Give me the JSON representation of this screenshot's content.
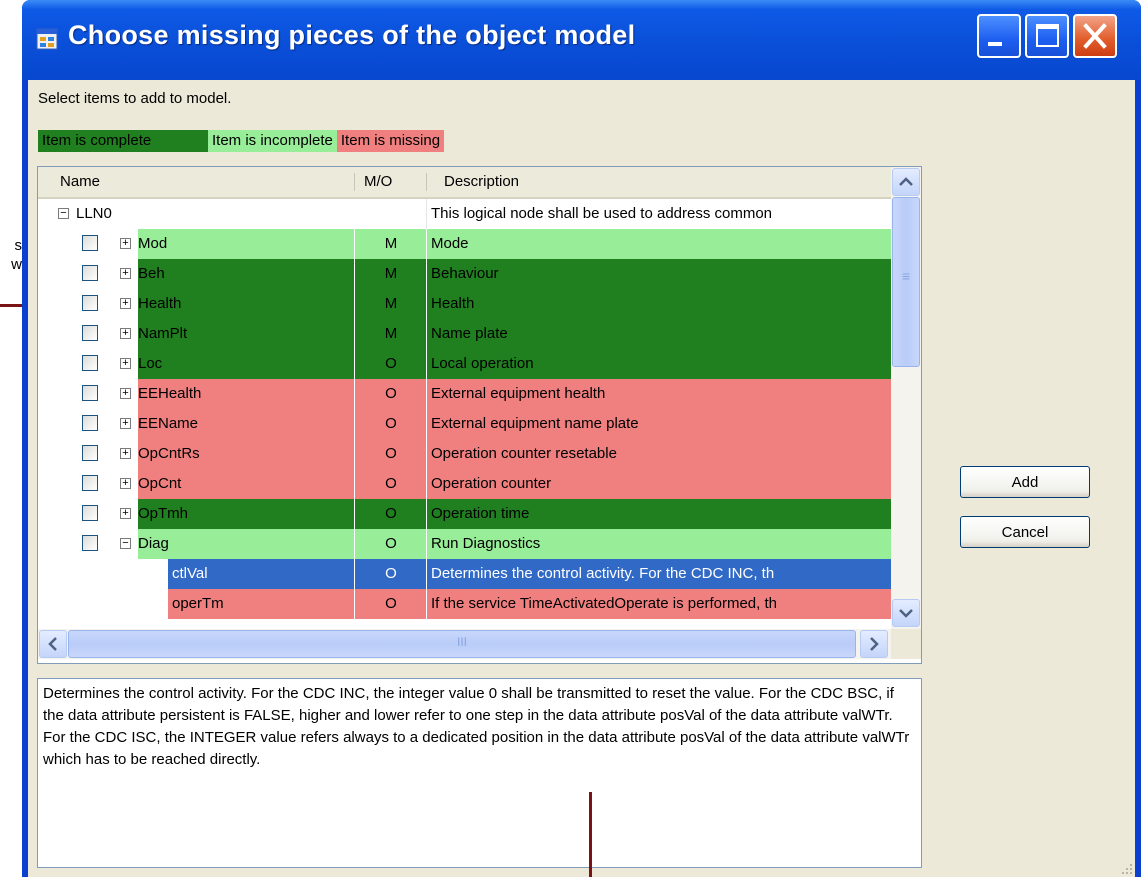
{
  "window": {
    "title": "Choose missing pieces of the object model"
  },
  "annotation_left": "s\nw",
  "instruction": "Select items to add to model.",
  "legend": {
    "complete": "Item is complete",
    "incomplete": "Item is incomplete",
    "missing": "Item is missing"
  },
  "columns": {
    "name": "Name",
    "mo": "M/O",
    "description": "Description"
  },
  "root": {
    "name": "LLN0",
    "description": "This logical node shall be used to address common"
  },
  "rows": [
    {
      "name": "Mod",
      "mo": "M",
      "description": "Mode",
      "status": "incomplete"
    },
    {
      "name": "Beh",
      "mo": "M",
      "description": "Behaviour",
      "status": "complete"
    },
    {
      "name": "Health",
      "mo": "M",
      "description": "Health",
      "status": "complete"
    },
    {
      "name": "NamPlt",
      "mo": "M",
      "description": "Name plate",
      "status": "complete"
    },
    {
      "name": "Loc",
      "mo": "O",
      "description": "Local operation",
      "status": "complete"
    },
    {
      "name": "EEHealth",
      "mo": "O",
      "description": "External equipment health",
      "status": "missing"
    },
    {
      "name": "EEName",
      "mo": "O",
      "description": "External equipment name plate",
      "status": "missing"
    },
    {
      "name": "OpCntRs",
      "mo": "O",
      "description": "Operation counter resetable",
      "status": "missing"
    },
    {
      "name": "OpCnt",
      "mo": "O",
      "description": "Operation counter",
      "status": "missing"
    },
    {
      "name": "OpTmh",
      "mo": "O",
      "description": "Operation time",
      "status": "complete"
    },
    {
      "name": "Diag",
      "mo": "O",
      "description": "Run Diagnostics",
      "status": "incomplete"
    }
  ],
  "children": [
    {
      "name": "ctlVal",
      "mo": "O",
      "description": "Determines the control activity. For the CDC INC, th",
      "status": "selected"
    },
    {
      "name": "operTm",
      "mo": "O",
      "description": "If the service TimeActivatedOperate is performed, th",
      "status": "missing"
    }
  ],
  "detail_text": "Determines the control activity. For the CDC INC, the integer value 0 shall be transmitted to reset the value. For the CDC BSC, if the data attribute persistent is FALSE, higher and lower refer to one step in the data attribute posVal of the data attribute valWTr. For the CDC ISC, the INTEGER value refers always to a dedicated position in the data attribute posVal of the data attribute valWTr which has to be reached directly.",
  "buttons": {
    "add": "Add",
    "cancel": "Cancel"
  },
  "colors": {
    "complete": "#208020",
    "incomplete": "#98ee98",
    "missing": "#f08080",
    "selected": "#3169c6",
    "titlebar": "#0a4fd8"
  },
  "scroll_h_thumb_label": "III",
  "scroll_v_thumb_label": "≡"
}
